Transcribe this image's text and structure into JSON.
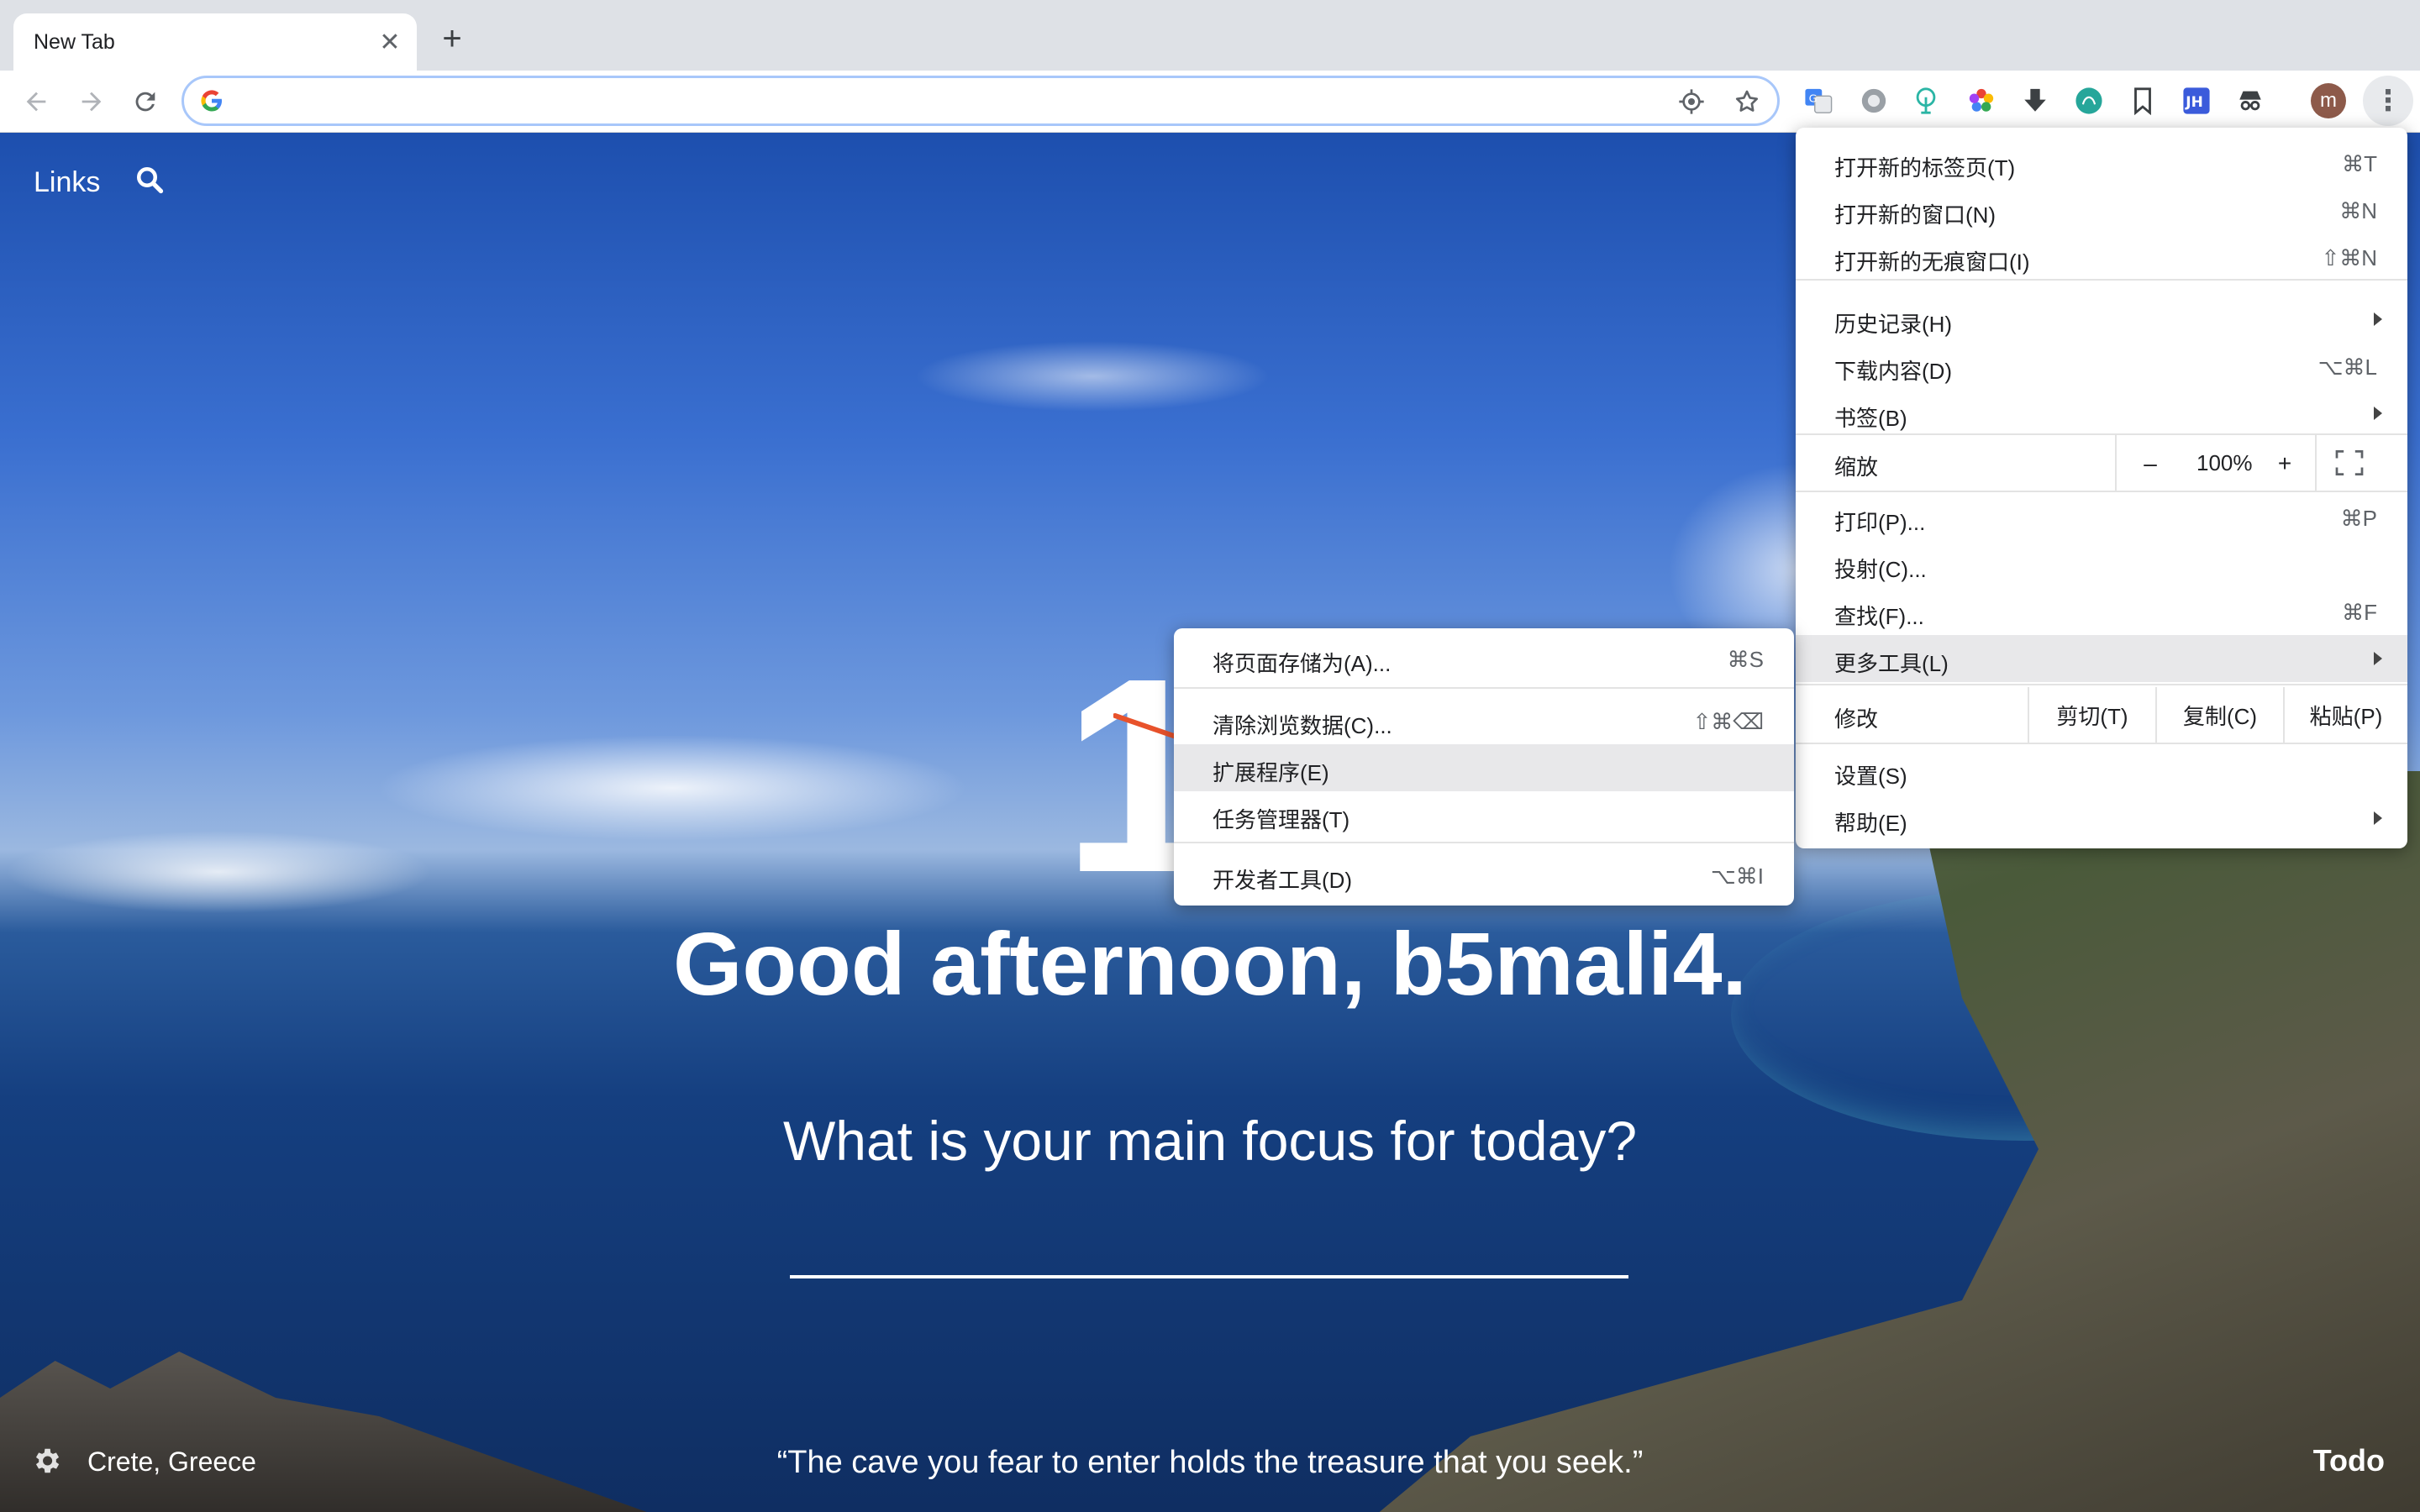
{
  "browser": {
    "tab_title": "New Tab",
    "close_glyph": "✕",
    "new_tab_glyph": "+",
    "avatar_letter": "m",
    "menu_glyph": "⋮",
    "extensions": [
      "translate-icon",
      "record-icon",
      "tree-icon",
      "color-wheel-icon",
      "download-icon",
      "teal-circle-icon",
      "bookmark-icon",
      "jh-icon",
      "incognito-icon"
    ],
    "jh_text": "JH"
  },
  "momentum": {
    "links_label": "Links",
    "clock": "16",
    "greeting": "Good afternoon, b5mali4.",
    "focus_question": "What is your main focus for today?",
    "location": "Crete, Greece",
    "quote": "“The cave you fear to enter holds the treasure that you seek.”",
    "todo": "Todo"
  },
  "menu": {
    "new_tab": {
      "label": "打开新的标签页(T)",
      "shortcut": "⌘T"
    },
    "new_window": {
      "label": "打开新的窗口(N)",
      "shortcut": "⌘N"
    },
    "incognito": {
      "label": "打开新的无痕窗口(I)",
      "shortcut": "⇧⌘N"
    },
    "history": {
      "label": "历史记录(H)"
    },
    "downloads": {
      "label": "下载内容(D)",
      "shortcut": "⌥⌘L"
    },
    "bookmarks": {
      "label": "书签(B)"
    },
    "zoom": {
      "label": "缩放",
      "minus": "–",
      "value": "100%",
      "plus": "+"
    },
    "print": {
      "label": "打印(P)...",
      "shortcut": "⌘P"
    },
    "cast": {
      "label": "投射(C)..."
    },
    "find": {
      "label": "查找(F)...",
      "shortcut": "⌘F"
    },
    "more_tools": {
      "label": "更多工具(L)"
    },
    "edit": {
      "label": "修改",
      "cut": "剪切(T)",
      "copy": "复制(C)",
      "paste": "粘贴(P)"
    },
    "settings": {
      "label": "设置(S)"
    },
    "help": {
      "label": "帮助(E)"
    }
  },
  "submenu": {
    "save_page": {
      "label": "将页面存储为(A)...",
      "shortcut": "⌘S"
    },
    "clear_data": {
      "label": "清除浏览数据(C)...",
      "shortcut": "⇧⌘⌫"
    },
    "extensions": {
      "label": "扩展程序(E)"
    },
    "task_manager": {
      "label": "任务管理器(T)"
    },
    "dev_tools": {
      "label": "开发者工具(D)",
      "shortcut": "⌥⌘I"
    }
  },
  "colors": {
    "annotation_arrow": "#e8522b",
    "menu_highlight": "#e8e8ea"
  }
}
